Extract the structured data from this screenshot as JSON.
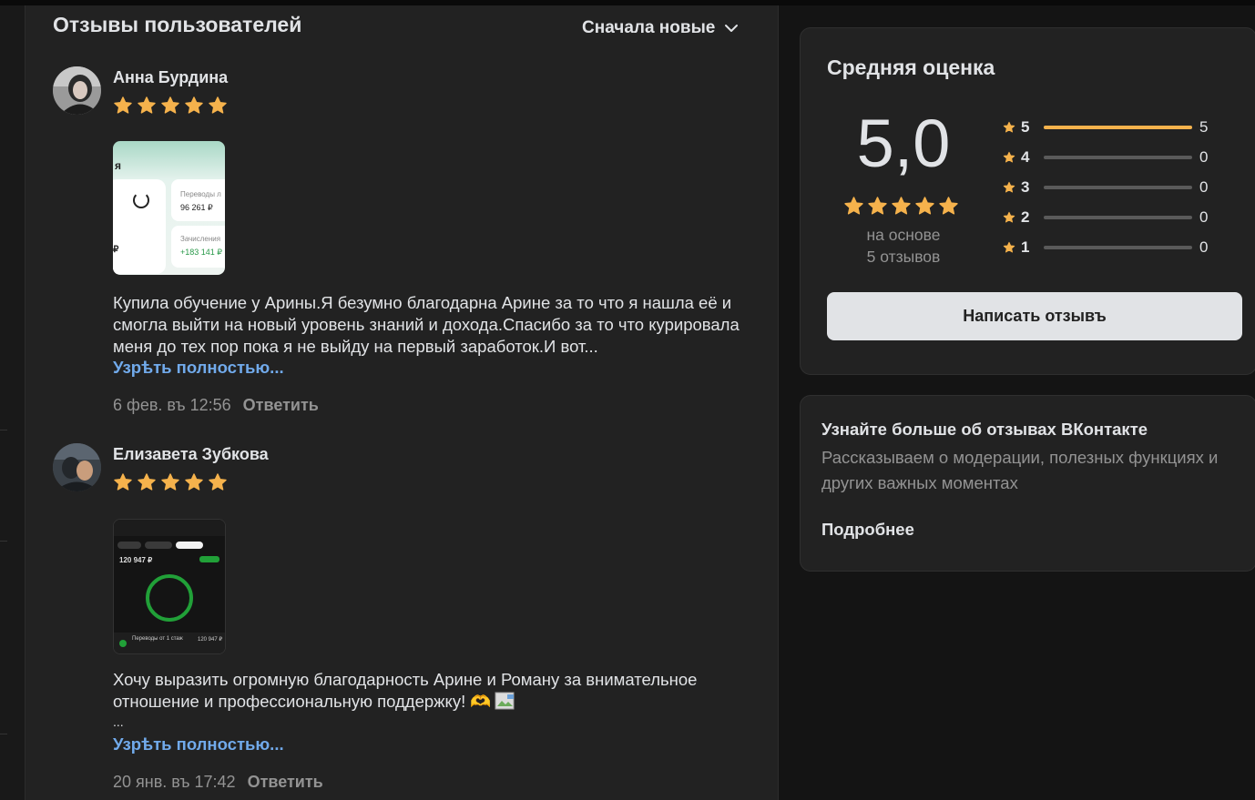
{
  "reviews_section": {
    "title": "Отзывы пользователей",
    "sort_label": "Сначала новые",
    "items": [
      {
        "author": "Анна Бурдина",
        "stars": 5,
        "text": "Купила обучение у Арины.Я безумно благодарна Арине за то что я нашла её и смогла выйти на новый уровень знаний и дохода.Спасибо за то что курировала меня до тех пор пока я не выйду на первый заработок.И вот...",
        "more_label": "Узрѣть полностью...",
        "date": "6 фев. въ 12:56",
        "reply_label": "Ответить",
        "screenshot": {
          "heading_fragment": "я",
          "card1_label": "Переводы л",
          "card1_value": "96 261 ₽",
          "card2_label": "Зачисления",
          "card2_value": "+183 141 ₽",
          "left_value": "₽"
        }
      },
      {
        "author": "Елизавета Зубкова",
        "stars": 5,
        "text_line1": "Хочу выразить огромную благодарность Арине и Роману за внимательное",
        "text_line2": "отношение и профессиональную поддержку! 🫶",
        "ellipsis": "...",
        "more_label": "Узрѣть полностью...",
        "date": "20 янв. въ 17:42",
        "reply_label": "Ответить",
        "screenshot": {
          "amount": "120 947 ₽",
          "bottom_label": "Переводы от 1 стаж",
          "bottom_value": "120 947 ₽"
        }
      }
    ]
  },
  "rating_panel": {
    "title": "Средняя оценка",
    "score": "5,0",
    "based_line1": "на основе",
    "based_line2": "5 отзывов",
    "total": 5,
    "distribution": [
      {
        "label": "5",
        "count": 5
      },
      {
        "label": "4",
        "count": 0
      },
      {
        "label": "3",
        "count": 0
      },
      {
        "label": "2",
        "count": 0
      },
      {
        "label": "1",
        "count": 0
      }
    ],
    "write_button": "Написать отзывъ"
  },
  "info_panel": {
    "title": "Узнайте больше об отзывах ВКонтакте",
    "text": "Рассказываем о модерации, полезных функциях и других важных моментах",
    "link": "Подробнее"
  },
  "colors": {
    "star": "#f5b24c",
    "link": "#71aaeb",
    "panel_bg": "#222222",
    "page_bg": "#141414",
    "muted_text": "#939393"
  }
}
